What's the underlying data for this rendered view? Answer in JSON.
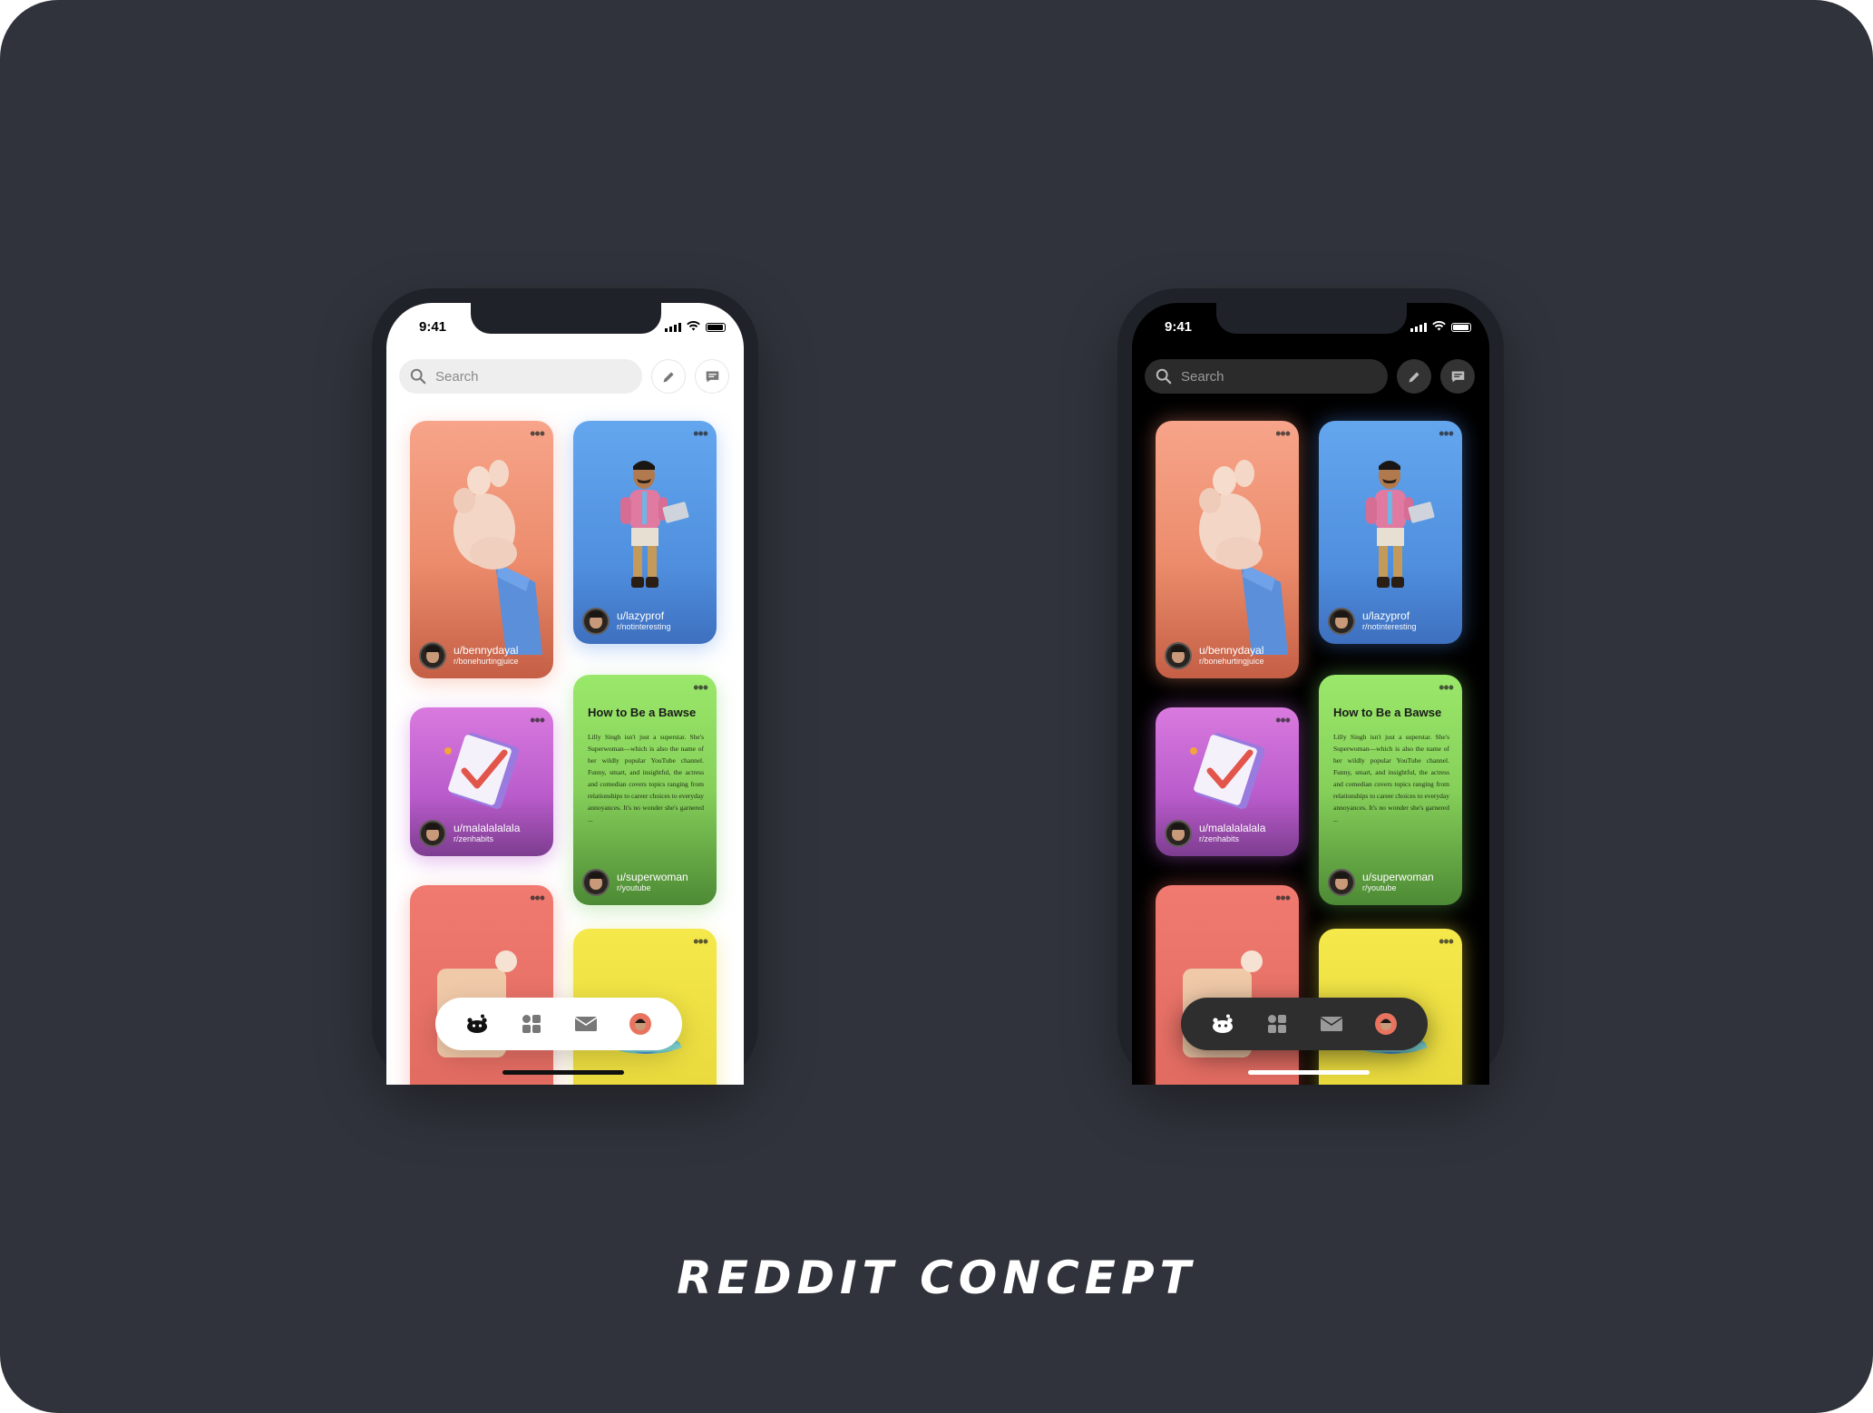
{
  "caption": "REDDIT CONCEPT",
  "status": {
    "time": "9:41"
  },
  "search": {
    "placeholder": "Search"
  },
  "posts": [
    {
      "user": "u/bennydayal",
      "subreddit": "r/bonehurtingjuice"
    },
    {
      "user": "u/lazyprof",
      "subreddit": "r/notinteresting"
    },
    {
      "user": "u/malalalalala",
      "subreddit": "r/zenhabits"
    },
    {
      "title": "How to Be a Bawse",
      "body": "Lilly Singh isn't just a superstar. She's Superwoman—which is also the name of her wildly popular YouTube channel. Funny, smart, and insightful, the actress and comedian covers topics ranging from relationships to career choices to everyday annoyances. It's no wonder she's garnered ...",
      "user": "u/superwoman",
      "subreddit": "r/youtube"
    }
  ],
  "nav_icons": [
    "reddit-home-icon",
    "grid-icon",
    "mail-icon",
    "profile-avatar-icon"
  ],
  "colors": {
    "background": "#30333b",
    "card_orange": "#f7a48a",
    "card_blue": "#64a6ee",
    "card_purple": "#d97adf",
    "card_green": "#9ae86a",
    "card_red": "#f07a70",
    "card_yellow": "#f4e84a"
  }
}
